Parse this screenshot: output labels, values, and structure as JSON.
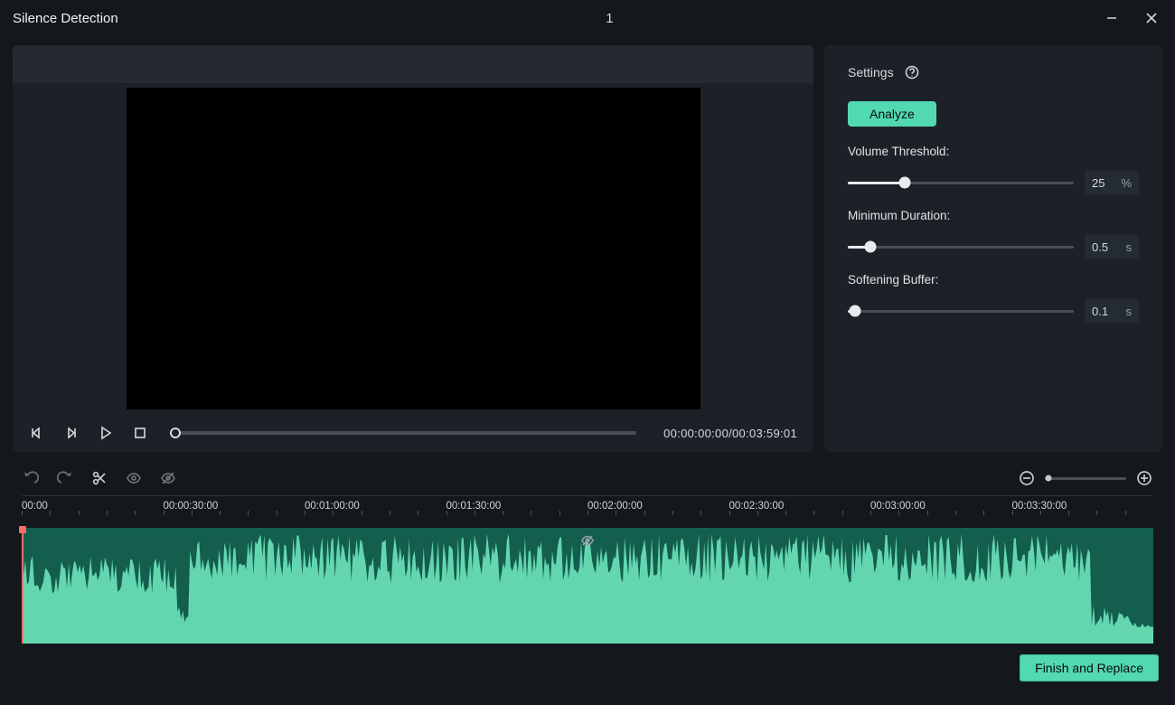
{
  "window": {
    "title": "Silence Detection",
    "document_name": "1"
  },
  "player": {
    "current_time": "00:00:00:00",
    "duration": "00:03:59:01",
    "time_display": "00:00:00:00/00:03:59:01",
    "progress_pct": 0
  },
  "settings": {
    "heading": "Settings",
    "analyze_label": "Analyze",
    "volume_threshold": {
      "label": "Volume Threshold:",
      "value": "25",
      "unit": "%",
      "pct": 25
    },
    "minimum_duration": {
      "label": "Minimum Duration:",
      "value": "0.5",
      "unit": "s",
      "pct": 10
    },
    "softening_buffer": {
      "label": "Softening Buffer:",
      "value": "0.1",
      "unit": "s",
      "pct": 3
    }
  },
  "ruler": {
    "labels": [
      "00:00",
      "00:00:30:00",
      "00:01:00:00",
      "00:01:30:00",
      "00:02:00:00",
      "00:02:30:00",
      "00:03:00:00",
      "00:03:30:00"
    ]
  },
  "footer": {
    "finish_label": "Finish and Replace"
  },
  "icons": {
    "minimize": "minimize-icon",
    "close": "close-icon",
    "prev_frame": "prev-frame-icon",
    "next_frame": "next-frame-icon",
    "play": "play-icon",
    "stop": "stop-icon",
    "undo": "undo-icon",
    "redo": "redo-icon",
    "cut": "scissors-icon",
    "eye": "eye-icon",
    "eye_off": "eye-off-icon",
    "zoom_out": "zoom-out-icon",
    "zoom_in": "zoom-in-icon",
    "help": "help-icon"
  }
}
